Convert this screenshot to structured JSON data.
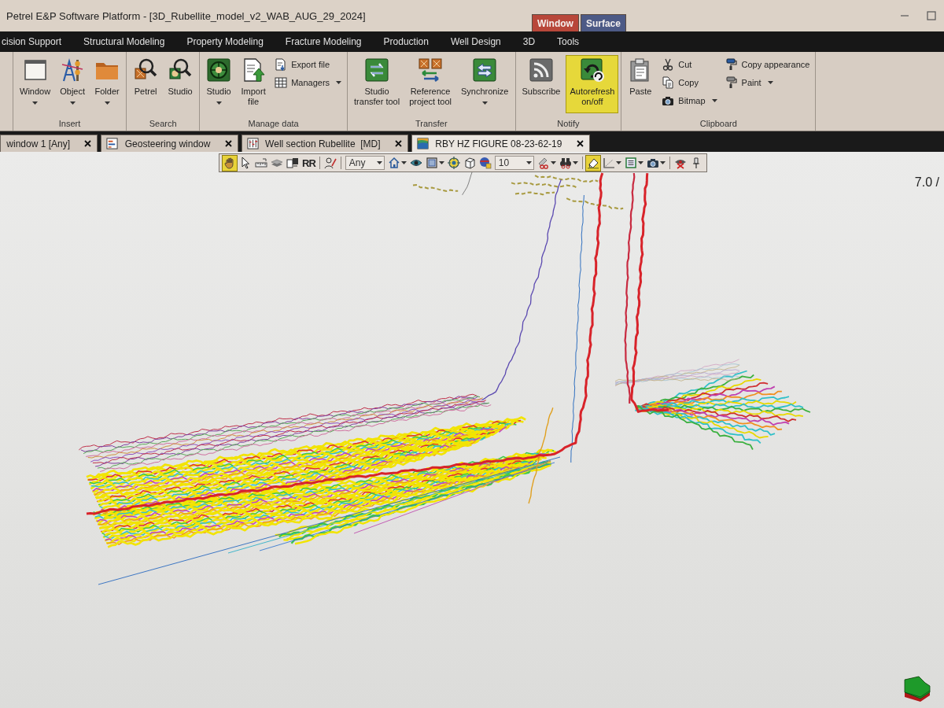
{
  "window": {
    "title": "Petrel E&P Software Platform - [3D_Rubellite_model_v2_WAB_AUG_29_2024]",
    "contextual_tabs": [
      {
        "label": "Window",
        "color": "#b8473a"
      },
      {
        "label": "Surface",
        "color": "#4d5a86"
      }
    ]
  },
  "ribbon_tabs": [
    "cision Support",
    "Structural Modeling",
    "Property Modeling",
    "Fracture Modeling",
    "Production",
    "Well Design",
    "3D",
    "Tools"
  ],
  "ribbon": {
    "groups": [
      {
        "label": "Insert",
        "items": [
          {
            "kind": "large",
            "label": "Window",
            "caret": true,
            "selected": false
          },
          {
            "kind": "large",
            "label": "Object",
            "caret": true,
            "selected": false
          },
          {
            "kind": "large",
            "label": "Folder",
            "caret": true,
            "selected": false
          }
        ]
      },
      {
        "label": "Search",
        "items": [
          {
            "kind": "large",
            "label": "Petrel",
            "caret": false,
            "selected": false
          },
          {
            "kind": "large",
            "label": "Studio",
            "caret": false,
            "selected": false
          }
        ]
      },
      {
        "label": "Manage data",
        "items": [
          {
            "kind": "large",
            "label": "Studio",
            "caret": true,
            "selected": false
          },
          {
            "kind": "large",
            "label": "Import\nfile",
            "caret": false,
            "selected": false
          },
          {
            "kind": "stack",
            "items": [
              {
                "label": "Export file",
                "caret": false,
                "selected": false
              },
              {
                "label": "Managers",
                "caret": true,
                "selected": false
              }
            ]
          }
        ]
      },
      {
        "label": "Transfer",
        "items": [
          {
            "kind": "large",
            "label": "Studio\ntransfer tool",
            "caret": false,
            "selected": false
          },
          {
            "kind": "large",
            "label": "Reference\nproject tool",
            "caret": false,
            "selected": false
          },
          {
            "kind": "large",
            "label": "Synchronize",
            "caret": true,
            "selected": false
          }
        ]
      },
      {
        "label": "Notify",
        "items": [
          {
            "kind": "large",
            "label": "Subscribe",
            "caret": false,
            "selected": false
          },
          {
            "kind": "large",
            "label": "Autorefresh\non/off",
            "caret": false,
            "selected": true
          }
        ]
      },
      {
        "label": "Clipboard",
        "items": [
          {
            "kind": "large",
            "label": "Paste",
            "caret": false,
            "selected": false
          },
          {
            "kind": "stack",
            "items": [
              {
                "label": "Cut",
                "caret": false,
                "selected": false
              },
              {
                "label": "Copy",
                "caret": false,
                "selected": false
              },
              {
                "label": "Bitmap",
                "caret": true,
                "selected": false
              }
            ]
          },
          {
            "kind": "stack",
            "items": [
              {
                "label": "Copy appearance",
                "caret": false,
                "selected": false
              },
              {
                "label": "Paint",
                "caret": true,
                "selected": false
              }
            ]
          }
        ]
      }
    ]
  },
  "document_tabs": [
    {
      "label": "window 1 [Any]",
      "selected": false
    },
    {
      "label": "Geosteering window",
      "selected": false
    },
    {
      "label": "Well section Rubellite  [MD]",
      "selected": false
    },
    {
      "label": "RBY HZ FIGURE 08-23-62-19",
      "selected": true
    }
  ],
  "view_toolbar": {
    "items": [
      {
        "kind": "tool",
        "selected": true,
        "caret": false
      },
      {
        "kind": "tool",
        "selected": false,
        "caret": false
      },
      {
        "kind": "tool",
        "selected": false,
        "caret": false
      },
      {
        "kind": "tool",
        "selected": false,
        "caret": false
      },
      {
        "kind": "tool",
        "selected": false,
        "caret": false
      },
      {
        "kind": "text",
        "label": "RR",
        "selected": false,
        "caret": false
      },
      {
        "kind": "separator"
      },
      {
        "kind": "tool",
        "selected": false,
        "caret": false
      },
      {
        "kind": "separator"
      },
      {
        "kind": "combo",
        "value": "Any"
      },
      {
        "kind": "tool",
        "selected": false,
        "caret": true
      },
      {
        "kind": "tool",
        "selected": false,
        "caret": false
      },
      {
        "kind": "tool",
        "selected": false,
        "caret": true
      },
      {
        "kind": "tool",
        "selected": false,
        "caret": false
      },
      {
        "kind": "tool",
        "selected": false,
        "caret": false
      },
      {
        "kind": "tool",
        "selected": false,
        "caret": false
      },
      {
        "kind": "combo",
        "value": "10"
      },
      {
        "kind": "tool",
        "selected": false,
        "caret": true
      },
      {
        "kind": "tool",
        "selected": false,
        "caret": true
      },
      {
        "kind": "separator"
      },
      {
        "kind": "tool",
        "selected": true,
        "caret": false
      },
      {
        "kind": "tool",
        "selected": false,
        "caret": true
      },
      {
        "kind": "tool",
        "selected": false,
        "caret": true
      },
      {
        "kind": "tool",
        "selected": false,
        "caret": true
      },
      {
        "kind": "separator"
      },
      {
        "kind": "tool",
        "selected": false,
        "caret": false
      },
      {
        "kind": "tool",
        "selected": false,
        "caret": false
      }
    ]
  },
  "viewer": {
    "readout": "7.0 /"
  }
}
